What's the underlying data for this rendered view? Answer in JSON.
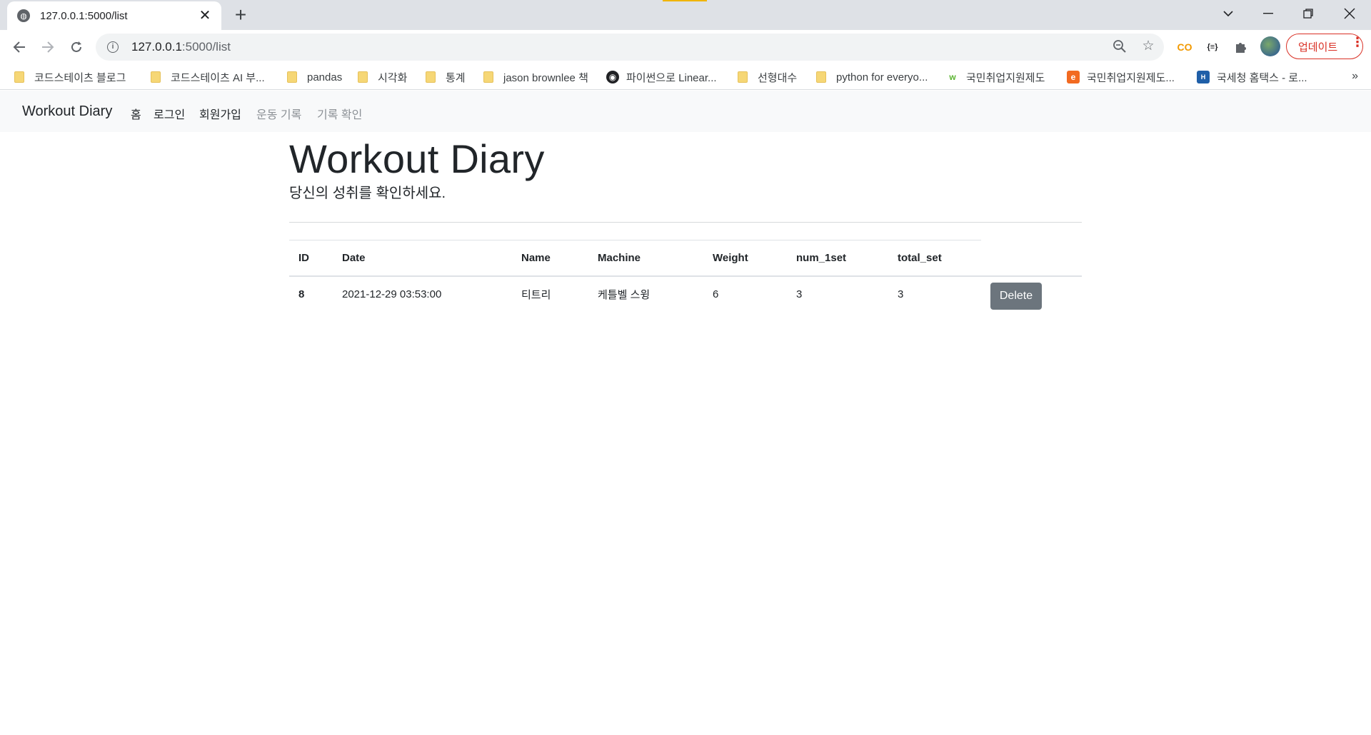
{
  "browser": {
    "tab_title": "127.0.0.1:5000/list",
    "url_host": "127.0.0.1",
    "url_path": ":5000/list",
    "update_label": "업데이트",
    "bookmarks": [
      {
        "label": "코드스테이츠 블로그",
        "kind": "folder"
      },
      {
        "label": "코드스테이츠 AI 부...",
        "kind": "folder"
      },
      {
        "label": "pandas",
        "kind": "folder"
      },
      {
        "label": "시각화",
        "kind": "folder"
      },
      {
        "label": "통계",
        "kind": "folder"
      },
      {
        "label": "jason brownlee 책",
        "kind": "folder"
      },
      {
        "label": "파이썬으로 Linear...",
        "kind": "site"
      },
      {
        "label": "선형대수",
        "kind": "folder"
      },
      {
        "label": "python for everyo...",
        "kind": "folder"
      },
      {
        "label": "국민취업지원제도",
        "kind": "site"
      },
      {
        "label": "국민취업지원제도...",
        "kind": "site"
      },
      {
        "label": "국세청 홈택스 - 로...",
        "kind": "site"
      }
    ],
    "bookmarks_more": "»"
  },
  "nav": {
    "brand": "Workout Diary",
    "links": [
      "홈",
      "로그인",
      "회원가입",
      "운동 기록",
      "기록 확인"
    ]
  },
  "hero": {
    "title": "Workout Diary",
    "subtitle": "당신의 성취를 확인하세요."
  },
  "table": {
    "headers": [
      "ID",
      "Date",
      "Name",
      "Machine",
      "Weight",
      "num_1set",
      "total_set"
    ],
    "rows": [
      {
        "id": "8",
        "date": "2021-12-29 03:53:00",
        "name": "티트리",
        "machine": "케틀벨 스윙",
        "weight": "6",
        "num_1set": "3",
        "total_set": "3",
        "action": "Delete"
      }
    ]
  },
  "colors": {
    "navbar_bg": "#f8f9fa",
    "delete_button": "#6c757d",
    "update_accent": "#d93025"
  }
}
